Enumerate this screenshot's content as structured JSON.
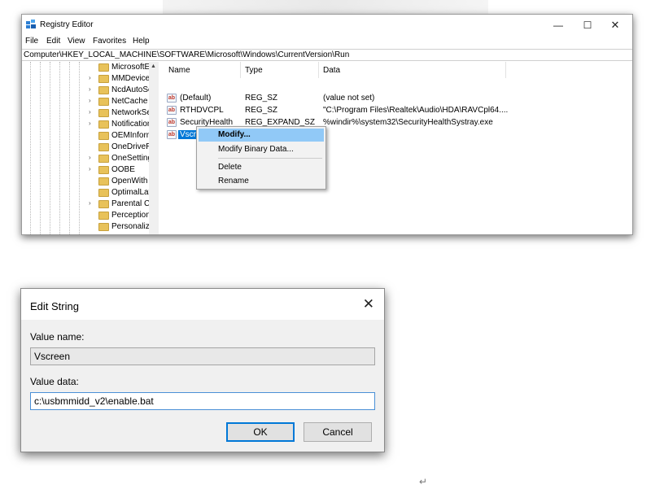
{
  "registry_editor": {
    "title": "Registry Editor",
    "window_controls": {
      "minimize": "—",
      "maximize": "☐",
      "close": "✕"
    },
    "menu": [
      "File",
      "Edit",
      "View",
      "Favorites",
      "Help"
    ],
    "address_path": "Computer\\HKEY_LOCAL_MACHINE\\SOFTWARE\\Microsoft\\Windows\\CurrentVersion\\Run",
    "tree": {
      "items": [
        {
          "label": "MicrosoftEdgeUpdate",
          "chevron": ""
        },
        {
          "label": "MMDevices",
          "chevron": "›"
        },
        {
          "label": "NcdAutoSetup",
          "chevron": "›"
        },
        {
          "label": "NetCache",
          "chevron": "›"
        },
        {
          "label": "NetworkServiceTriggers",
          "chevron": "›"
        },
        {
          "label": "Notifications",
          "chevron": "›"
        },
        {
          "label": "OEMInformation",
          "chevron": ""
        },
        {
          "label": "OneDriveRamps",
          "chevron": ""
        },
        {
          "label": "OneSettings",
          "chevron": "›"
        },
        {
          "label": "OOBE",
          "chevron": "›"
        },
        {
          "label": "OpenWith",
          "chevron": ""
        },
        {
          "label": "OptimalLayout",
          "chevron": ""
        },
        {
          "label": "Parental Controls",
          "chevron": "›"
        },
        {
          "label": "PerceptionSimulationExtensions",
          "chevron": ""
        },
        {
          "label": "Personalization",
          "chevron": ""
        }
      ],
      "scroll_up_glyph": "▲"
    },
    "list": {
      "headers": {
        "name": "Name",
        "type": "Type",
        "data": "Data"
      },
      "rows": [
        {
          "icon": "ab",
          "name": "(Default)",
          "type": "REG_SZ",
          "data": "(value not set)"
        },
        {
          "icon": "ab",
          "name": "RTHDVCPL",
          "type": "REG_SZ",
          "data": "\"C:\\Program Files\\Realtek\\Audio\\HDA\\RAVCpl64...."
        },
        {
          "icon": "ab",
          "name": "SecurityHealth",
          "type": "REG_EXPAND_SZ",
          "data": "%windir%\\system32\\SecurityHealthSystray.exe"
        },
        {
          "icon": "ab",
          "name": "Vscreen",
          "type": "REG_SZ",
          "data": ""
        }
      ]
    },
    "context_menu": {
      "items": [
        "Modify...",
        "Modify Binary Data...",
        "Delete",
        "Rename"
      ]
    }
  },
  "edit_string_dialog": {
    "title": "Edit String",
    "close_glyph": "✕",
    "value_name_label": "Value name:",
    "value_name": "Vscreen",
    "value_data_label": "Value data:",
    "value_data": "c:\\usbmmidd_v2\\enable.bat",
    "ok_label": "OK",
    "cancel_label": "Cancel"
  },
  "colors": {
    "selection": "#0078d7",
    "menu_highlight": "#91c9f7",
    "folder": "#e8c25a"
  },
  "return_mark": "↵"
}
